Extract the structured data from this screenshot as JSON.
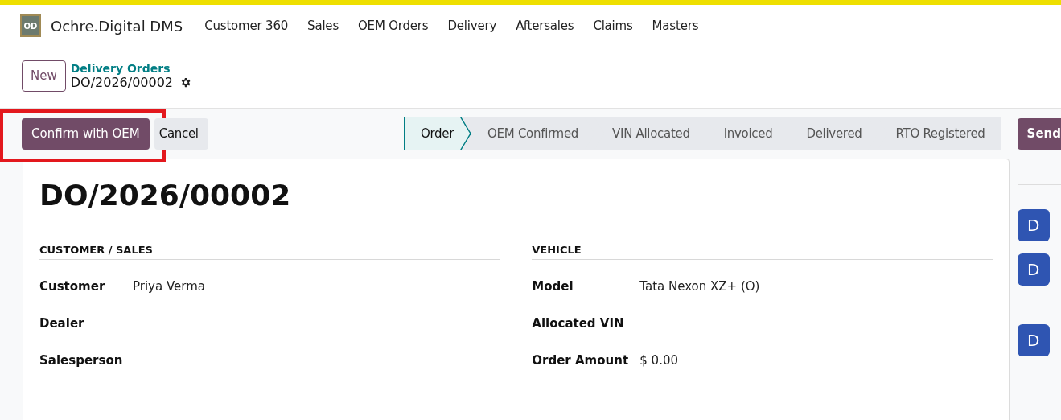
{
  "app": {
    "logo": "OD",
    "name": "Ochre.Digital DMS"
  },
  "menu": [
    "Customer 360",
    "Sales",
    "OEM Orders",
    "Delivery",
    "Aftersales",
    "Claims",
    "Masters"
  ],
  "control_panel": {
    "new_button": "New",
    "breadcrumb": "Delivery Orders",
    "record": "DO/2026/00002"
  },
  "actions": [
    {
      "label": "Confirm with OEM",
      "kind": "primary",
      "highlighted": true
    },
    {
      "label": "Cancel",
      "kind": "secondary",
      "highlighted": false
    }
  ],
  "stages": [
    {
      "label": "Order",
      "selected": true
    },
    {
      "label": "OEM Confirmed",
      "selected": false
    },
    {
      "label": "VIN Allocated",
      "selected": false
    },
    {
      "label": "Invoiced",
      "selected": false
    },
    {
      "label": "Delivered",
      "selected": false
    },
    {
      "label": "RTO Registered",
      "selected": false
    }
  ],
  "send_button": "Send",
  "form": {
    "title": "DO/2026/00002",
    "groups": [
      {
        "heading": "CUSTOMER / SALES",
        "fields": [
          {
            "label": "Customer",
            "value": "Priya Verma"
          },
          {
            "label": "Dealer"
          },
          {
            "label": "Salesperson"
          }
        ]
      },
      {
        "heading": "VEHICLE",
        "fields": [
          {
            "label": "Model",
            "value": "Tata Nexon XZ+ (O)"
          },
          {
            "label": "Allocated VIN"
          },
          {
            "label": "Order Amount",
            "value": "$ 0.00"
          }
        ]
      }
    ]
  },
  "chatter": {
    "avatars": [
      "D",
      "D",
      "D"
    ]
  }
}
